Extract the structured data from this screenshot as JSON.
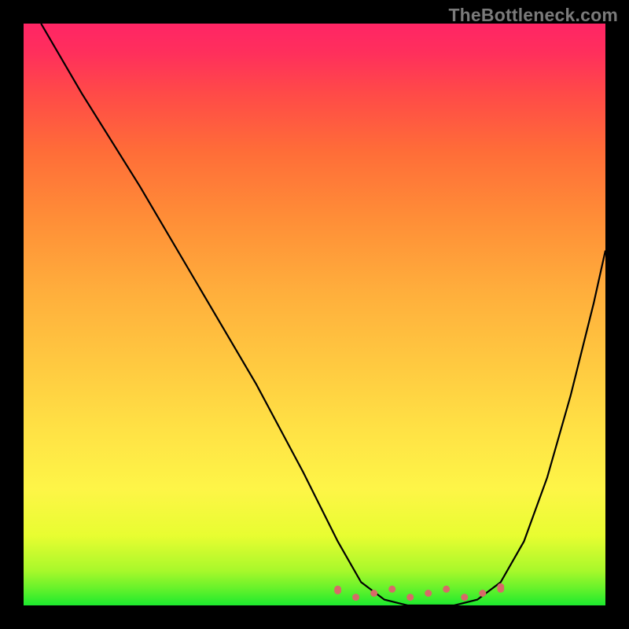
{
  "watermark": "TheBottleneck.com",
  "chart_data": {
    "type": "line",
    "title": "",
    "xlabel": "",
    "ylabel": "",
    "xlim": [
      0,
      100
    ],
    "ylim": [
      0,
      100
    ],
    "series": [
      {
        "name": "curve",
        "color": "#000000",
        "x": [
          3,
          10,
          20,
          30,
          40,
          48,
          54,
          58,
          62,
          66,
          70,
          74,
          78,
          82,
          86,
          90,
          94,
          98,
          100
        ],
        "y": [
          100,
          88,
          72,
          55,
          38,
          23,
          11,
          4,
          1,
          0,
          0,
          0,
          1,
          4,
          11,
          22,
          36,
          52,
          61
        ]
      }
    ],
    "flat_region": {
      "color": "#d76a68",
      "x": [
        54,
        82
      ],
      "y": [
        1,
        1
      ]
    },
    "background_gradient": {
      "direction": "vertical",
      "stops": [
        {
          "pos": 0.0,
          "color": "#1dea2e"
        },
        {
          "pos": 0.12,
          "color": "#e8fd31"
        },
        {
          "pos": 0.3,
          "color": "#ffe245"
        },
        {
          "pos": 0.66,
          "color": "#ff8f37"
        },
        {
          "pos": 1.0,
          "color": "#ff2565"
        }
      ]
    }
  }
}
